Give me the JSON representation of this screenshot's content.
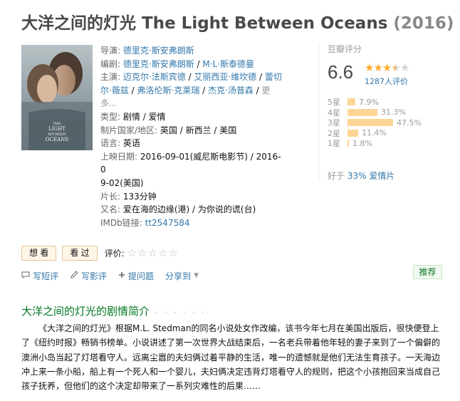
{
  "movie": {
    "title": "大洋之间的灯光 The Light Between Oceans",
    "year": "(2016)"
  },
  "poster": {
    "caption_the": "THE",
    "caption_light": "LIGHT",
    "caption_between": "BETWEEN",
    "caption_oceans": "OCEANS"
  },
  "info": {
    "director_label": "导演:",
    "director": "德里克·斯安弗朗斯",
    "writer_label": "编剧:",
    "writer_1": "德里克·斯安弗朗斯",
    "writer_2": "M·L·斯泰德曼",
    "cast_label": "主演:",
    "cast_1": "迈克尔·法斯宾德",
    "cast_2": "艾丽西亚·维坎德",
    "cast_3": "蕾切尔·薇兹",
    "cast_4": "弗洛伦斯·克莱瑞",
    "cast_5": "杰克·汤普森",
    "cast_more": "更多...",
    "genre_label": "类型:",
    "genre": "剧情 / 爱情",
    "country_label": "制片国家/地区:",
    "country": "英国 / 新西兰 / 美国",
    "language_label": "语言:",
    "language": "英语",
    "release_label": "上映日期:",
    "release_1": "2016-09-01(威尼斯电影节) / 2016-0",
    "release_2": "9-02(美国)",
    "runtime_label": "片长:",
    "runtime": "133分钟",
    "aka_label": "又名:",
    "aka": "爱在海的边缘(港) / 为你说的谎(台)",
    "imdb_label": "IMDb链接:",
    "imdb": "tt2547584"
  },
  "rating": {
    "label": "豆瓣评分",
    "score": "6.6",
    "stars": 3.5,
    "votes": "1287人评价",
    "better_than_prefix": "好于",
    "better_than_value": "33% 爱情片",
    "distribution": [
      {
        "label": "5星",
        "pct": "7.9%",
        "value": 7.9
      },
      {
        "label": "4星",
        "pct": "31.3%",
        "value": 31.3
      },
      {
        "label": "3星",
        "pct": "47.5%",
        "value": 47.5
      },
      {
        "label": "2星",
        "pct": "11.4%",
        "value": 11.4
      },
      {
        "label": "1星",
        "pct": "1.8%",
        "value": 1.8
      }
    ]
  },
  "actions": {
    "want": "想 看",
    "seen": "看 过",
    "rate_label": "评价:",
    "empty_stars": "☆☆☆☆☆"
  },
  "ops": {
    "short_review": "写短评",
    "review": "写影评",
    "question": "提问题",
    "share": "分享到",
    "recommend": "推荐"
  },
  "summary": {
    "title": "大洋之间的灯光的剧情简介",
    "dots": "· · · · · ·",
    "text": "《大洋之间的灯光》根据M.L. Stedman的同名小说处女作改编，该书今年七月在美国出版后，很快便登上了《纽约时报》畅销书榜单。小说讲述了第一次世界大战结束后，一名老兵带着他年轻的妻子来到了一个偏僻的澳洲小岛当起了灯塔看守人。远离尘嚣的夫妇俩过着平静的生活，唯一的遗憾就是他们无法生育孩子。一天海边冲上来一条小船，船上有一个死人和一个婴儿，夫妇俩决定违背灯塔看守人的规则，把这个小孩抱回来当成自己孩子抚养，但他们的这个决定却带来了一系列灾难性的后果……"
  },
  "colors": {
    "link": "#3377aa",
    "green": "#007722",
    "star": "#ffac2d",
    "bar": "#ffd596"
  }
}
